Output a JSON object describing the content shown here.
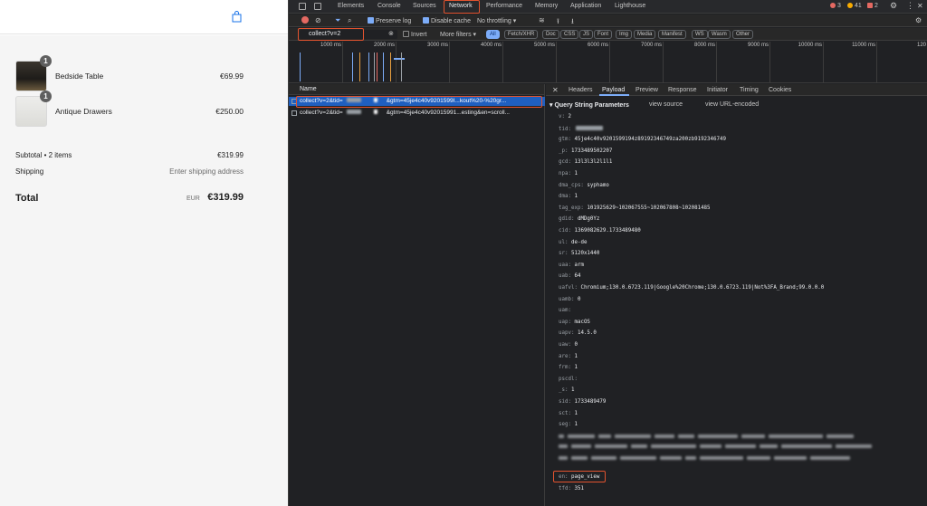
{
  "shop": {
    "items": [
      {
        "name": "Bedside Table",
        "price": "€69.99",
        "qty": "1"
      },
      {
        "name": "Antique Drawers",
        "price": "€250.00",
        "qty": "1"
      }
    ],
    "subtotal_label": "Subtotal • 2 items",
    "subtotal_value": "€319.99",
    "shipping_label": "Shipping",
    "shipping_value": "Enter shipping address",
    "total_label": "Total",
    "total_currency": "EUR",
    "total_value": "€319.99"
  },
  "devtools": {
    "tabs": [
      "Elements",
      "Console",
      "Sources",
      "Network",
      "Performance",
      "Memory",
      "Application",
      "Lighthouse"
    ],
    "active_tab": "Network",
    "status": {
      "errors": "3",
      "warnings": "41",
      "info": "2"
    },
    "toolbar": {
      "preserve_log": "Preserve log",
      "disable_cache": "Disable cache",
      "throttling": "No throttling"
    },
    "filter": {
      "value": "collect?v=2",
      "invert": "Invert",
      "more_filters": "More filters ▾"
    },
    "filter_chips": [
      "All",
      "Fetch/XHR",
      "Doc",
      "CSS",
      "JS",
      "Font",
      "Img",
      "Media",
      "Manifest",
      "WS",
      "Wasm",
      "Other"
    ],
    "timeline_ticks": [
      "1000 ms",
      "2000 ms",
      "3000 ms",
      "4000 ms",
      "5000 ms",
      "6000 ms",
      "7000 ms",
      "8000 ms",
      "9000 ms",
      "10000 ms",
      "11000 ms",
      "120"
    ],
    "list_header": "Name",
    "requests": [
      {
        "a": "collect?v=2&tid=",
        "b": "&gtm=45je4c40v9201599I...kout%20-%20gr..."
      },
      {
        "a": "collect?v=2&tid=",
        "b": "&gtm=45je4c40v92015991...esting&en=scroll..."
      }
    ],
    "detail_tabs": [
      "Headers",
      "Payload",
      "Preview",
      "Response",
      "Initiator",
      "Timing",
      "Cookies"
    ],
    "active_detail_tab": "Payload",
    "qs_header": "▾ Query String Parameters",
    "view_source": "view source",
    "view_url_encoded": "view URL-encoded",
    "params": [
      {
        "k": "v:",
        "v": "2"
      },
      {
        "k": "tid:",
        "v": ""
      },
      {
        "k": "gtm:",
        "v": "45je4c40v9201599194z89192346749za200zb9192346749"
      },
      {
        "k": "_p:",
        "v": "1733489502207"
      },
      {
        "k": "gcd:",
        "v": "13l3l3l2l1l1"
      },
      {
        "k": "npa:",
        "v": "1"
      },
      {
        "k": "dma_cps:",
        "v": "syphamo"
      },
      {
        "k": "dma:",
        "v": "1"
      },
      {
        "k": "tag_exp:",
        "v": "101925629~102067555~102067808~102081485"
      },
      {
        "k": "gdid:",
        "v": "dMDg0Yz"
      },
      {
        "k": "cid:",
        "v": "1369082629.1733489480"
      },
      {
        "k": "ul:",
        "v": "de-de"
      },
      {
        "k": "sr:",
        "v": "5120x1440"
      },
      {
        "k": "uaa:",
        "v": "arm"
      },
      {
        "k": "uab:",
        "v": "64"
      },
      {
        "k": "uafvl:",
        "v": "Chromium;130.0.6723.119|Google%20Chrome;130.0.6723.119|Not%3FA_Brand;99.0.0.0"
      },
      {
        "k": "uamb:",
        "v": "0"
      },
      {
        "k": "uam:",
        "v": ""
      },
      {
        "k": "uap:",
        "v": "macOS"
      },
      {
        "k": "uapv:",
        "v": "14.5.0"
      },
      {
        "k": "uaw:",
        "v": "0"
      },
      {
        "k": "are:",
        "v": "1"
      },
      {
        "k": "frm:",
        "v": "1"
      },
      {
        "k": "pscdl:",
        "v": ""
      },
      {
        "k": "_s:",
        "v": "1"
      },
      {
        "k": "sid:",
        "v": "1733489479"
      },
      {
        "k": "sct:",
        "v": "1"
      },
      {
        "k": "seg:",
        "v": "1"
      }
    ],
    "en_param": {
      "k": "en:",
      "v": "page_view"
    },
    "tfd_param": {
      "k": "tfd:",
      "v": "351"
    }
  }
}
